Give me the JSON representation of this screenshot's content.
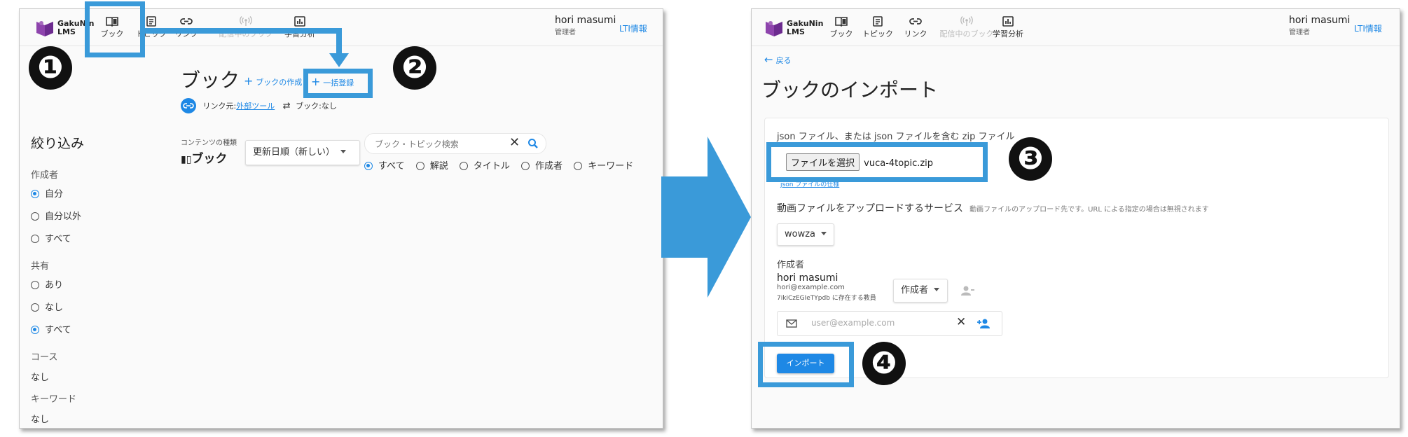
{
  "brand": {
    "line1": "GakuNin",
    "line2": "LMS",
    "accent": "#1e88e5",
    "highlight": "#3a9ad9"
  },
  "nav": [
    {
      "label": "ブック"
    },
    {
      "label": "トピック"
    },
    {
      "label": "リンク"
    },
    {
      "label": "配信中のブック"
    },
    {
      "label": "学習分析"
    }
  ],
  "user": {
    "name": "hori masumi",
    "role": "管理者",
    "lti": "LTI情報"
  },
  "left": {
    "title": "ブック",
    "create": "ブックの作成",
    "bulk": "一括登録",
    "link_prefix": "リンク元:",
    "link_tool": "外部ツール",
    "link_book": "ブック:なし",
    "filter_title": "絞り込み",
    "groups": [
      {
        "label": "作成者",
        "options": [
          {
            "text": "自分",
            "on": true
          },
          {
            "text": "自分以外",
            "on": false
          },
          {
            "text": "すべて",
            "on": false
          }
        ]
      },
      {
        "label": "共有",
        "options": [
          {
            "text": "あり",
            "on": false
          },
          {
            "text": "なし",
            "on": false
          },
          {
            "text": "すべて",
            "on": true
          }
        ]
      }
    ],
    "course_label": "コース",
    "course_value": "なし",
    "keyword_label": "キーワード",
    "keyword_value": "なし",
    "content_type_label": "コンテンツの種類",
    "content_type_value": "ブック",
    "sort_value": "更新日順（新しい）",
    "search_placeholder": "ブック・トピック検索",
    "search_scopes": [
      {
        "text": "すべて",
        "on": true
      },
      {
        "text": "解説",
        "on": false
      },
      {
        "text": "タイトル",
        "on": false
      },
      {
        "text": "作成者",
        "on": false
      },
      {
        "text": "キーワード",
        "on": false
      }
    ]
  },
  "right": {
    "back": "戻る",
    "title": "ブックのインポート",
    "file_label": "json ファイル、または json ファイルを含む zip ファイル",
    "file_button": "ファイルを選択",
    "file_name": "vuca-4topic.zip",
    "file_spec_link": "json ファイルの仕様",
    "service_label": "動画ファイルをアップロードするサービス",
    "service_hint": "動画ファイルのアップロード先です。URL による指定の場合は無視されます",
    "service_value": "wowza",
    "author_label": "作成者",
    "author_name": "hori masumi",
    "author_email": "hori@example.com",
    "author_note": "7ikiCzEGIeTYpdb に存在する教員",
    "author_role": "作成者",
    "email_placeholder": "user@example.com",
    "import_button": "インポート"
  },
  "markers": [
    "❶",
    "❷",
    "❸",
    "❹"
  ]
}
